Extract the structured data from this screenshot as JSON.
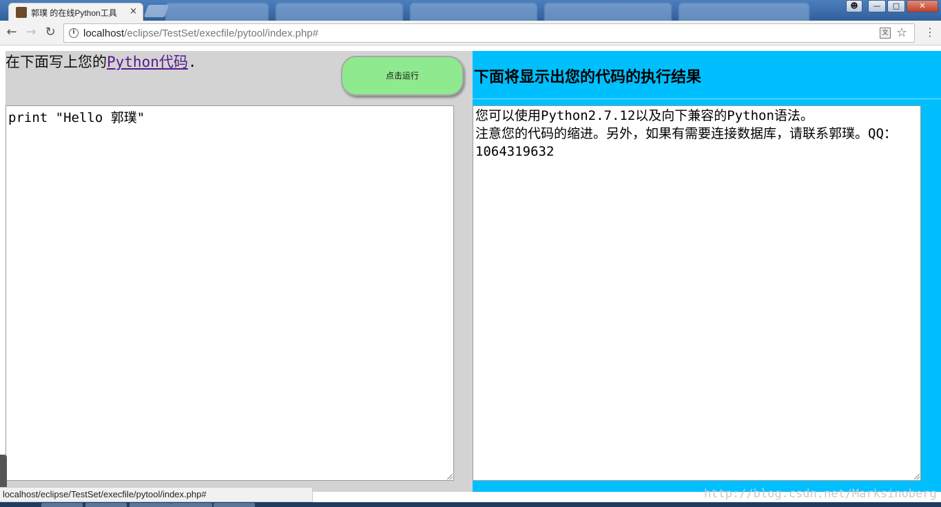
{
  "browser": {
    "active_tab_title": "郭璞 的在线Python工具",
    "tab_close": "×",
    "url_host": "localhost",
    "url_path": "/eclipse/TestSet/execfile/pytool/index.php#",
    "status_url": "localhost/eclipse/TestSet/execfile/pytool/index.php#"
  },
  "left": {
    "prompt_prefix": "在下面写上您的",
    "prompt_link": "Python代码",
    "prompt_suffix": ".",
    "run_button": "点击运行",
    "code": "print \"Hello 郭璞\""
  },
  "right": {
    "heading": "下面将显示出您的代码的执行结果",
    "line1": "您可以使用Python2.7.12以及向下兼容的Python语法。",
    "line2": "注意您的代码的缩进。另外，如果有需要连接数据库，请联系郭璞。QQ：1064319632"
  },
  "watermark": "http://blog.csdn.net/Marksinoberg",
  "colors": {
    "run_button_bg": "#8fe98f",
    "right_panel_bg": "#00bfff",
    "left_panel_bg": "#d3d3d3"
  }
}
